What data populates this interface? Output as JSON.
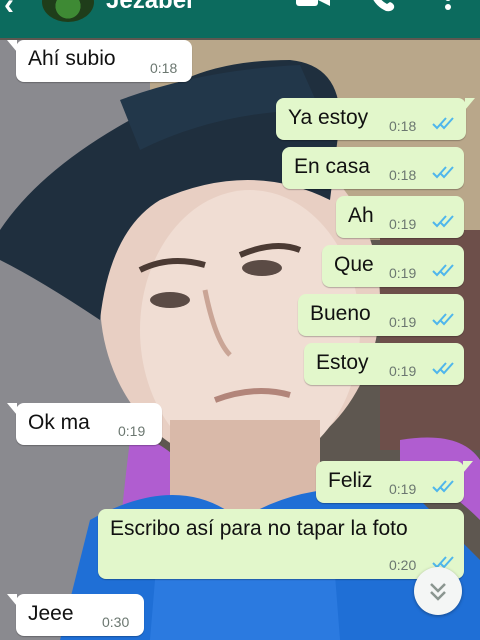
{
  "header": {
    "back_icon": "arrow-back-icon",
    "contact_name": "Jezabel",
    "icons": [
      "video-call-icon",
      "phone-icon",
      "more-vert-icon"
    ],
    "background_color": "#0c6b5e"
  },
  "messages": [
    {
      "direction": "in",
      "text": "Ahí subio",
      "time": "0:18"
    },
    {
      "direction": "out",
      "text": "Ya estoy",
      "time": "0:18",
      "status": "read"
    },
    {
      "direction": "out",
      "text": "En casa",
      "time": "0:18",
      "status": "read"
    },
    {
      "direction": "out",
      "text": "Ah",
      "time": "0:19",
      "status": "read"
    },
    {
      "direction": "out",
      "text": "Que",
      "time": "0:19",
      "status": "read"
    },
    {
      "direction": "out",
      "text": "Bueno",
      "time": "0:19",
      "status": "read"
    },
    {
      "direction": "out",
      "text": "Estoy",
      "time": "0:19",
      "status": "read"
    },
    {
      "direction": "in",
      "text": "Ok ma",
      "time": "0:19"
    },
    {
      "direction": "out",
      "text": "Feliz",
      "time": "0:19",
      "status": "read"
    },
    {
      "direction": "out",
      "text": "Escribo así para no tapar la foto",
      "time": "0:20",
      "status": "read"
    },
    {
      "direction": "in",
      "text": "Jeee",
      "time": "0:30"
    }
  ],
  "colors": {
    "outgoing_bubble": "#e2f7cb",
    "incoming_bubble": "#ffffff",
    "read_ticks": "#4fb6ec"
  },
  "scroll_button_icon": "double-chevron-down-icon"
}
